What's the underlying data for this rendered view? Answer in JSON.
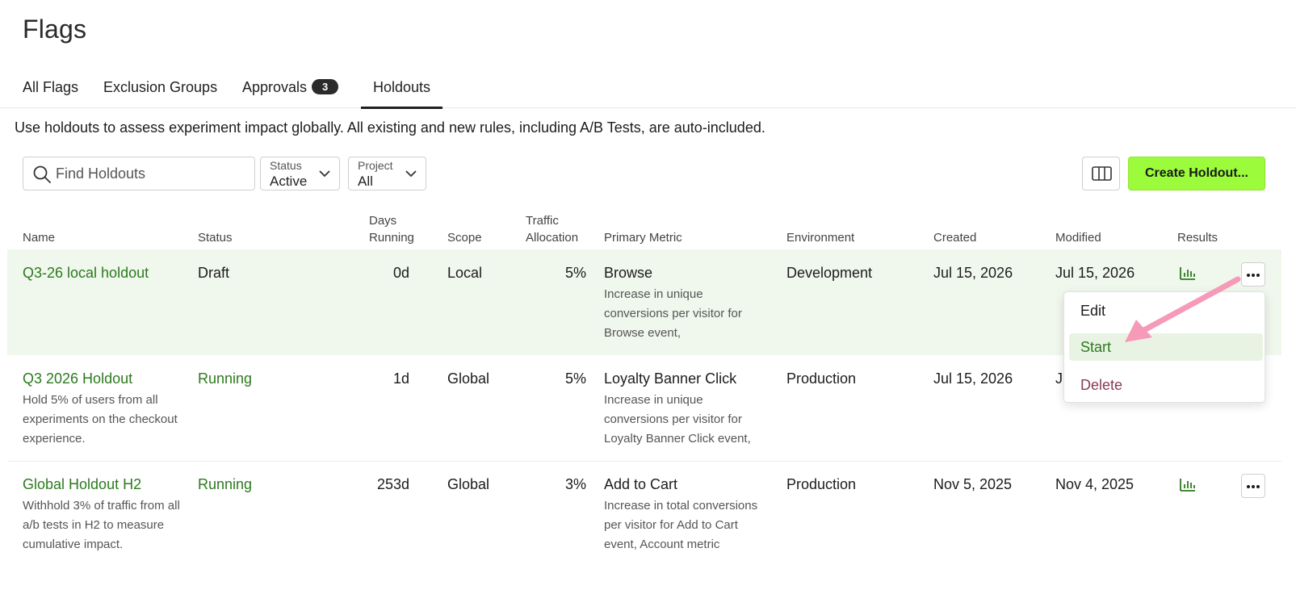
{
  "page": {
    "title": "Flags"
  },
  "tabs": [
    {
      "label": "All Flags"
    },
    {
      "label": "Exclusion Groups"
    },
    {
      "label": "Approvals",
      "badge": "3"
    },
    {
      "label": "Holdouts",
      "active": true
    }
  ],
  "intro": "Use holdouts to assess experiment impact globally. All existing and new rules, including A/B Tests, are auto-included.",
  "toolbar": {
    "search_placeholder": "Find Holdouts",
    "status_filter": {
      "label": "Status",
      "value": "Active"
    },
    "project_filter": {
      "label": "Project",
      "value": "All"
    },
    "create_label": "Create Holdout..."
  },
  "table": {
    "headers": {
      "name": "Name",
      "status": "Status",
      "days_running_1": "Days",
      "days_running_2": "Running",
      "scope": "Scope",
      "traffic_1": "Traffic",
      "traffic_2": "Allocation",
      "primary_metric": "Primary Metric",
      "environment": "Environment",
      "created": "Created",
      "modified": "Modified",
      "results": "Results"
    },
    "rows": [
      {
        "name": "Q3-26 local holdout",
        "description": "",
        "status": "Draft",
        "days": "0d",
        "scope": "Local",
        "traffic": "5%",
        "metric": "Browse",
        "metric_desc": "Increase in unique conversions per visitor for Browse event,",
        "environment": "Development",
        "created": "Jul 15, 2026",
        "modified": "Jul 15, 2026"
      },
      {
        "name": "Q3 2026 Holdout",
        "description": "Hold 5% of users from all experiments on the checkout experience.",
        "status": "Running",
        "days": "1d",
        "scope": "Global",
        "traffic": "5%",
        "metric": "Loyalty Banner Click",
        "metric_desc": "Increase in unique conversions per visitor for Loyalty Banner Click event,",
        "environment": "Production",
        "created": "Jul 15, 2026",
        "modified": "J"
      },
      {
        "name": "Global Holdout H2",
        "description": "Withhold 3% of traffic from all a/b tests in H2 to measure cumulative impact.",
        "status": "Running",
        "days": "253d",
        "scope": "Global",
        "traffic": "3%",
        "metric": "Add to Cart",
        "metric_desc": "Increase in total conversions per visitor for Add to Cart event, Account metric",
        "environment": "Production",
        "created": "Nov 5, 2025",
        "modified": "Nov 4, 2025"
      }
    ]
  },
  "menu": {
    "edit": "Edit",
    "start": "Start",
    "delete": "Delete"
  },
  "colors": {
    "accent": "#9cfb3b",
    "link": "#2c7a1e",
    "highlight_row": "#f0f7ec",
    "arrow": "#f59ab8",
    "danger": "#8a3a59"
  }
}
